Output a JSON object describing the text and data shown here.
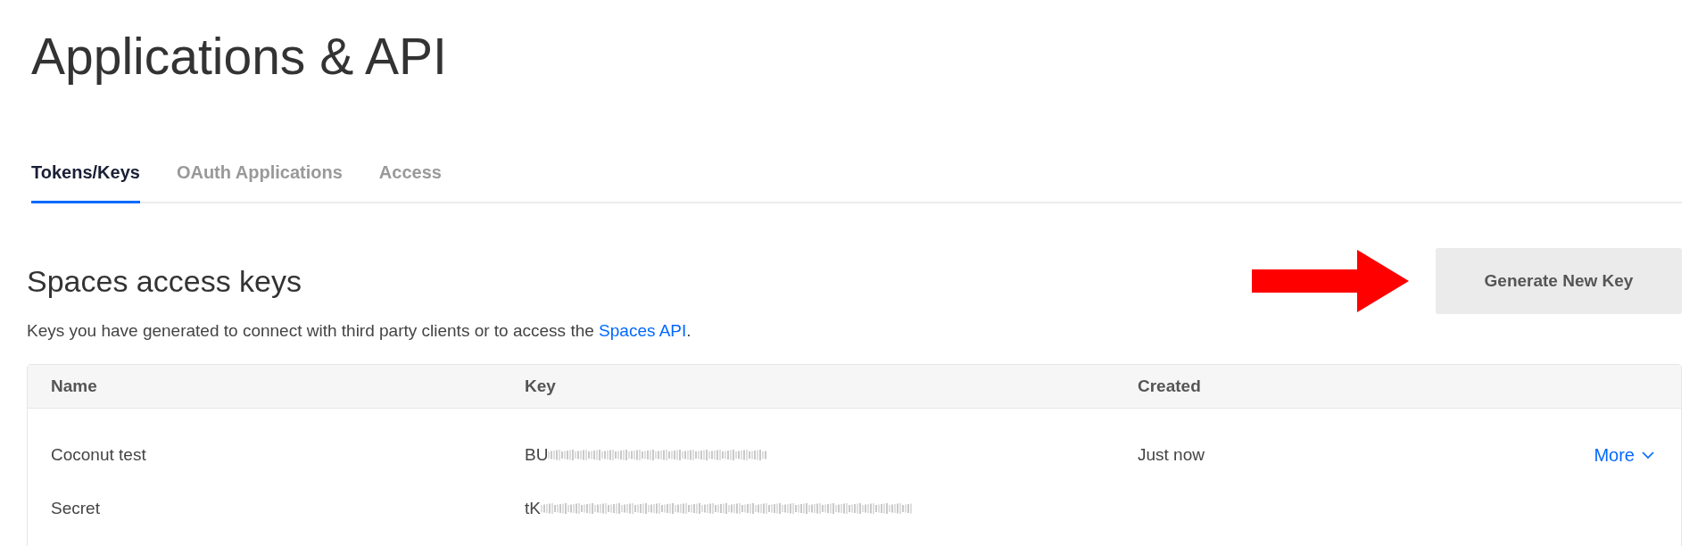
{
  "page": {
    "title": "Applications & API"
  },
  "tabs": [
    {
      "label": "Tokens/Keys",
      "selected": true
    },
    {
      "label": "OAuth Applications",
      "selected": false
    },
    {
      "label": "Access",
      "selected": false
    }
  ],
  "section": {
    "title": "Spaces access keys",
    "description": "Keys you have generated to connect with third party clients or to access the ",
    "link": "Spaces API",
    "description_end": ".",
    "button": "Generate New Key"
  },
  "table": {
    "columns": [
      "Name",
      "Key",
      "Created"
    ],
    "rows": [
      {
        "name": "Coconut test",
        "key": "BU",
        "created": "Just now",
        "action": "More"
      },
      {
        "name": "Secret",
        "key": "tK"
      }
    ]
  }
}
